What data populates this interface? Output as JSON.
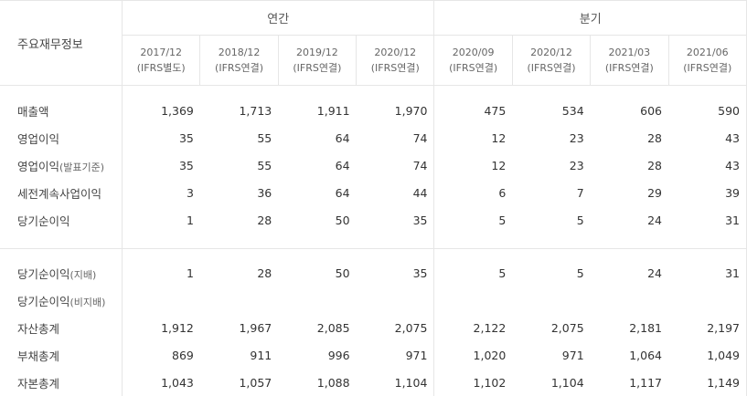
{
  "header": {
    "corner": "주요재무정보",
    "groups": {
      "annual": "연간",
      "quarterly": "분기"
    },
    "periods": [
      {
        "date": "2017/12",
        "basis": "(IFRS별도)"
      },
      {
        "date": "2018/12",
        "basis": "(IFRS연결)"
      },
      {
        "date": "2019/12",
        "basis": "(IFRS연결)"
      },
      {
        "date": "2020/12",
        "basis": "(IFRS연결)"
      },
      {
        "date": "2020/09",
        "basis": "(IFRS연결)"
      },
      {
        "date": "2020/12",
        "basis": "(IFRS연결)"
      },
      {
        "date": "2021/03",
        "basis": "(IFRS연결)"
      },
      {
        "date": "2021/06",
        "basis": "(IFRS연결)"
      }
    ]
  },
  "rows": [
    {
      "label": "매출액",
      "sub": "",
      "values": [
        "1,369",
        "1,713",
        "1,911",
        "1,970",
        "475",
        "534",
        "606",
        "590"
      ]
    },
    {
      "label": "영업이익",
      "sub": "",
      "values": [
        "35",
        "55",
        "64",
        "74",
        "12",
        "23",
        "28",
        "43"
      ]
    },
    {
      "label": "영업이익",
      "sub": "(발표기준)",
      "values": [
        "35",
        "55",
        "64",
        "74",
        "12",
        "23",
        "28",
        "43"
      ]
    },
    {
      "label": "세전계속사업이익",
      "sub": "",
      "values": [
        "3",
        "36",
        "64",
        "44",
        "6",
        "7",
        "29",
        "39"
      ]
    },
    {
      "label": "당기순이익",
      "sub": "",
      "values": [
        "1",
        "28",
        "50",
        "35",
        "5",
        "5",
        "24",
        "31"
      ]
    },
    {
      "label": "당기순이익",
      "sub": "(지배)",
      "values": [
        "1",
        "28",
        "50",
        "35",
        "5",
        "5",
        "24",
        "31"
      ]
    },
    {
      "label": "당기순이익",
      "sub": "(비지배)",
      "values": [
        "",
        "",
        "",
        "",
        "",
        "",
        "",
        ""
      ]
    },
    {
      "label": "자산총계",
      "sub": "",
      "values": [
        "1,912",
        "1,967",
        "2,085",
        "2,075",
        "2,122",
        "2,075",
        "2,181",
        "2,197"
      ]
    },
    {
      "label": "부채총계",
      "sub": "",
      "values": [
        "869",
        "911",
        "996",
        "971",
        "1,020",
        "971",
        "1,064",
        "1,049"
      ]
    },
    {
      "label": "자본총계",
      "sub": "",
      "values": [
        "1,043",
        "1,057",
        "1,088",
        "1,104",
        "1,102",
        "1,104",
        "1,117",
        "1,149"
      ]
    }
  ]
}
